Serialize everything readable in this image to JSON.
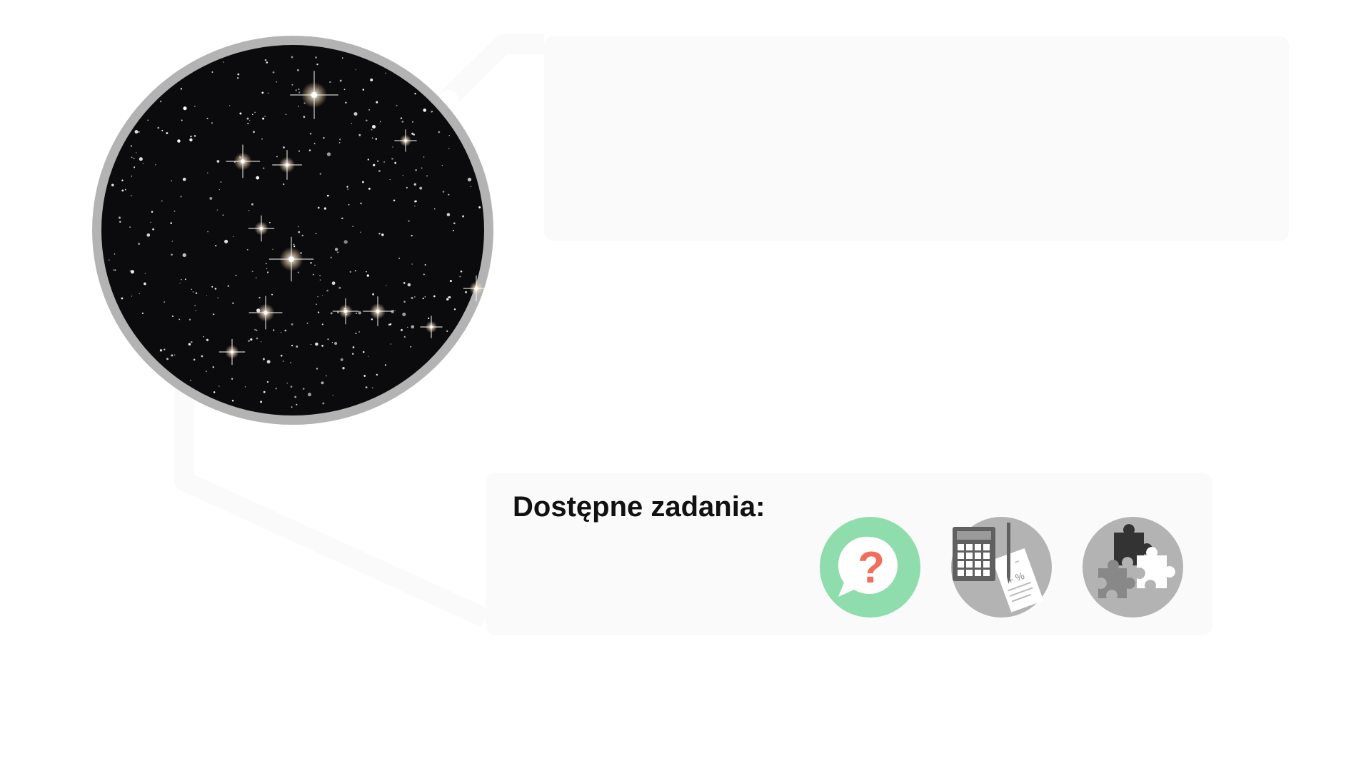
{
  "tasks": {
    "title": "Dostępne zadania:",
    "items": [
      {
        "name": "quiz",
        "icon": "question-speech-bubble-icon",
        "color": "#8fdcad"
      },
      {
        "name": "calculation",
        "icon": "calculator-notes-icon",
        "color": "#b3b3b3"
      },
      {
        "name": "puzzle",
        "icon": "puzzle-pieces-icon",
        "color": "#b3b3b3"
      }
    ]
  },
  "colors": {
    "panel_bg": "#fafafa",
    "circle_border": "#b3b3b3",
    "quiz_accent": "#8fdcad",
    "question_mark": "#f26e5c"
  }
}
